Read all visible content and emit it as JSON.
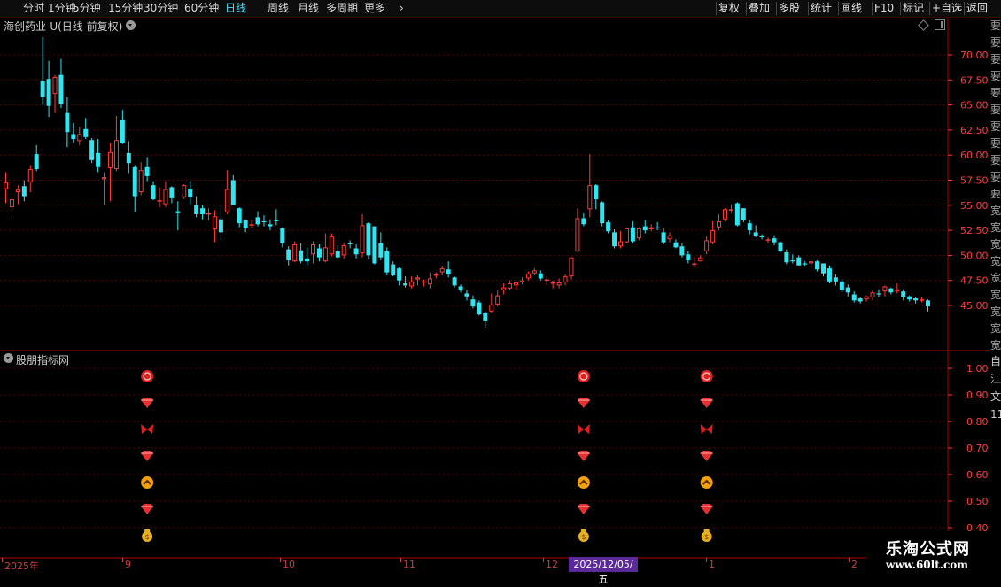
{
  "toolbar": {
    "timeframes": [
      "分时",
      "1分钟",
      "5分钟",
      "15分钟",
      "30分钟",
      "60分钟",
      "日线",
      "周线",
      "月线",
      "多周期",
      "更多"
    ],
    "active_timeframe": "日线",
    "right_buttons": [
      "复权",
      "叠加",
      "多股",
      "统计",
      "画线",
      "F10",
      "标记",
      "+自选",
      "返回"
    ]
  },
  "chart_title": "海创药业-U(日线 前复权)",
  "indicator_title": "股朋指标网",
  "right_strip_glyphs": "要要要要要要要要要要要宽宽宽宽宽宽宽宽宽宽",
  "right_strip2_glyphs": "自江文1111111",
  "date_highlight": "2025/12/05/五",
  "watermark": {
    "line1": "乐淘公式网",
    "line2": "www.60lt.com"
  },
  "colors": {
    "up": "#ff3a3a",
    "down": "#2fe6f0",
    "grid": "#5a0000",
    "axis": "#ff3c3c",
    "tf_active": "#3ee6ff"
  },
  "icons_column": [
    "gem-badge-icon",
    "diamond-icon",
    "butterfly-icon",
    "diamond-icon",
    "chevron-up-coin-icon",
    "diamond-icon",
    "money-bag-icon"
  ],
  "chart_data": {
    "type": "candlestick",
    "price_axis": {
      "ticks": [
        "70.00",
        "67.50",
        "65.00",
        "62.50",
        "60.00",
        "57.50",
        "55.00",
        "52.50",
        "50.00",
        "47.50",
        "45.00"
      ]
    },
    "indicator_axis": {
      "ticks": [
        "1.00",
        "0.90",
        "0.80",
        "0.70",
        "0.60",
        "0.50",
        "0.40"
      ]
    },
    "x_labels": [
      "2025年",
      "9",
      "10",
      "11",
      "12",
      "1",
      "2"
    ],
    "signal_columns_at_candles": [
      23,
      94,
      114
    ],
    "candles": [
      [
        56.6,
        57.3,
        55.2,
        58.3
      ],
      [
        54.8,
        55.6,
        53.6,
        56.2
      ],
      [
        56.3,
        56.6,
        55.1,
        57.0
      ],
      [
        56.9,
        55.9,
        55.4,
        57.5
      ],
      [
        57.3,
        58.6,
        56.3,
        59.0
      ],
      [
        60.1,
        58.6,
        58.4,
        61.0
      ],
      [
        67.4,
        65.8,
        65.0,
        71.8
      ],
      [
        67.6,
        64.9,
        63.8,
        69.4
      ],
      [
        66.1,
        67.8,
        64.2,
        68.0
      ],
      [
        68.0,
        65.1,
        64.7,
        69.6
      ],
      [
        64.2,
        62.3,
        60.8,
        65.8
      ],
      [
        62.1,
        61.6,
        61.2,
        63.2
      ],
      [
        61.4,
        62.1,
        61.0,
        62.8
      ],
      [
        62.6,
        61.8,
        61.6,
        63.7
      ],
      [
        61.5,
        59.5,
        59.2,
        61.7
      ],
      [
        60.2,
        58.8,
        58.3,
        61.6
      ],
      [
        57.6,
        57.8,
        55.0,
        58.3
      ],
      [
        58.7,
        60.3,
        55.4,
        61.2
      ],
      [
        58.6,
        61.5,
        58.4,
        63.9
      ],
      [
        63.5,
        61.2,
        61.1,
        64.5
      ],
      [
        60.2,
        59.2,
        58.2,
        61.4
      ],
      [
        58.8,
        55.9,
        54.3,
        59.0
      ],
      [
        56.3,
        58.5,
        56.0,
        59.3
      ],
      [
        58.8,
        57.9,
        57.4,
        59.8
      ],
      [
        57.0,
        55.6,
        55.5,
        57.4
      ],
      [
        55.5,
        55.5,
        54.8,
        56.8
      ],
      [
        55.1,
        56.6,
        54.8,
        57.4
      ],
      [
        56.8,
        55.7,
        55.2,
        56.9
      ],
      [
        54.4,
        54.2,
        52.5,
        55.4
      ],
      [
        55.8,
        57.0,
        55.6,
        57.1
      ],
      [
        56.6,
        55.8,
        55.0,
        57.4
      ],
      [
        55.0,
        54.1,
        53.8,
        55.9
      ],
      [
        54.7,
        54.1,
        53.6,
        55.0
      ],
      [
        54.1,
        54.2,
        53.5,
        54.7
      ],
      [
        52.6,
        53.9,
        51.3,
        54.5
      ],
      [
        53.6,
        52.3,
        51.5,
        54.9
      ],
      [
        54.3,
        56.6,
        54.1,
        58.5
      ],
      [
        57.5,
        55.0,
        55.0,
        58.0
      ],
      [
        54.7,
        53.2,
        52.8,
        54.8
      ],
      [
        53.5,
        52.7,
        52.3,
        53.6
      ],
      [
        53.0,
        53.1,
        52.7,
        53.5
      ],
      [
        53.8,
        53.1,
        52.9,
        54.4
      ],
      [
        53.4,
        53.3,
        52.9,
        54.0
      ],
      [
        53.1,
        52.9,
        52.5,
        53.6
      ],
      [
        53.5,
        53.4,
        53.0,
        54.6
      ],
      [
        52.7,
        51.2,
        50.8,
        52.8
      ],
      [
        50.6,
        49.5,
        49.0,
        50.9
      ],
      [
        49.4,
        51.1,
        49.3,
        51.4
      ],
      [
        50.5,
        49.4,
        49.2,
        51.2
      ],
      [
        49.7,
        49.4,
        49.0,
        50.8
      ],
      [
        50.1,
        51.1,
        49.2,
        51.4
      ],
      [
        50.7,
        49.8,
        49.4,
        51.1
      ],
      [
        49.4,
        50.8,
        49.3,
        52.2
      ],
      [
        50.1,
        51.9,
        49.9,
        52.2
      ],
      [
        50.4,
        49.8,
        49.6,
        51.0
      ],
      [
        50.0,
        51.0,
        49.7,
        51.3
      ],
      [
        51.2,
        51.1,
        50.7,
        51.5
      ],
      [
        50.7,
        50.1,
        49.7,
        51.1
      ],
      [
        50.2,
        53.0,
        49.8,
        54.1
      ],
      [
        53.2,
        50.0,
        49.6,
        53.3
      ],
      [
        52.9,
        49.2,
        49.1,
        52.9
      ],
      [
        51.2,
        49.8,
        49.5,
        52.3
      ],
      [
        50.4,
        48.3,
        48.0,
        50.8
      ],
      [
        49.1,
        48.0,
        47.9,
        49.4
      ],
      [
        48.7,
        47.5,
        47.0,
        48.8
      ],
      [
        47.2,
        47.0,
        46.8,
        47.9
      ],
      [
        46.9,
        47.4,
        46.7,
        47.9
      ],
      [
        47.6,
        47.8,
        47.0,
        48.0
      ],
      [
        47.3,
        47.4,
        46.9,
        47.6
      ],
      [
        47.1,
        47.7,
        46.7,
        48.3
      ],
      [
        48.0,
        48.1,
        47.7,
        48.3
      ],
      [
        48.3,
        48.7,
        48.0,
        48.9
      ],
      [
        48.6,
        48.1,
        47.8,
        49.4
      ],
      [
        47.8,
        47.0,
        46.8,
        47.9
      ],
      [
        46.9,
        46.5,
        46.3,
        47.1
      ],
      [
        46.2,
        45.9,
        45.5,
        46.6
      ],
      [
        45.6,
        44.9,
        44.7,
        46.0
      ],
      [
        45.3,
        44.1,
        44.0,
        45.5
      ],
      [
        44.3,
        43.5,
        42.8,
        44.4
      ],
      [
        44.4,
        45.1,
        44.3,
        46.2
      ],
      [
        45.1,
        46.0,
        44.9,
        46.5
      ],
      [
        46.5,
        46.8,
        46.1,
        47.2
      ],
      [
        46.7,
        47.2,
        46.5,
        47.5
      ],
      [
        47.0,
        47.3,
        46.6,
        47.4
      ],
      [
        47.3,
        47.5,
        47.1,
        47.8
      ],
      [
        47.7,
        48.2,
        47.5,
        48.4
      ],
      [
        48.2,
        48.5,
        48.0,
        48.7
      ],
      [
        48.2,
        47.7,
        47.5,
        48.5
      ],
      [
        47.6,
        47.6,
        47.0,
        47.9
      ],
      [
        47.2,
        47.3,
        46.7,
        47.5
      ],
      [
        47.0,
        47.3,
        46.7,
        47.7
      ],
      [
        47.3,
        47.9,
        47.0,
        48.1
      ],
      [
        47.9,
        49.8,
        47.6,
        49.8
      ],
      [
        50.4,
        53.7,
        50.3,
        54.7
      ],
      [
        53.7,
        53.1,
        52.9,
        54.2
      ],
      [
        54.6,
        57.0,
        53.8,
        60.1
      ],
      [
        57.0,
        55.6,
        54.6,
        57.1
      ],
      [
        55.3,
        53.2,
        52.9,
        55.4
      ],
      [
        53.3,
        52.4,
        52.2,
        53.5
      ],
      [
        52.3,
        50.9,
        50.7,
        52.6
      ],
      [
        50.9,
        51.4,
        50.7,
        52.4
      ],
      [
        51.3,
        52.7,
        51.2,
        52.8
      ],
      [
        52.8,
        51.4,
        51.2,
        53.4
      ],
      [
        51.7,
        52.7,
        51.5,
        52.8
      ],
      [
        52.9,
        52.5,
        52.2,
        53.5
      ],
      [
        52.6,
        52.8,
        52.4,
        53.1
      ],
      [
        52.8,
        52.7,
        52.5,
        53.3
      ],
      [
        52.3,
        51.3,
        51.1,
        52.7
      ],
      [
        51.6,
        52.0,
        51.3,
        52.3
      ],
      [
        51.3,
        50.8,
        50.7,
        51.6
      ],
      [
        50.9,
        50.0,
        49.8,
        51.2
      ],
      [
        50.1,
        49.5,
        49.2,
        50.4
      ],
      [
        49.1,
        49.2,
        48.8,
        49.9
      ],
      [
        49.4,
        49.8,
        49.4,
        50.0
      ],
      [
        50.4,
        51.5,
        50.1,
        51.9
      ],
      [
        51.3,
        52.5,
        51.1,
        53.4
      ],
      [
        52.8,
        53.4,
        52.5,
        54.1
      ],
      [
        53.6,
        54.6,
        53.4,
        54.7
      ],
      [
        54.5,
        54.6,
        54.2,
        55.1
      ],
      [
        55.2,
        53.0,
        52.9,
        55.3
      ],
      [
        54.7,
        53.5,
        53.3,
        54.7
      ],
      [
        53.2,
        52.5,
        52.1,
        53.5
      ],
      [
        52.3,
        51.9,
        51.8,
        53.0
      ],
      [
        51.9,
        51.8,
        51.6,
        52.1
      ],
      [
        51.6,
        51.6,
        51.2,
        51.8
      ],
      [
        51.7,
        51.3,
        51.0,
        52.0
      ],
      [
        51.3,
        50.4,
        50.3,
        51.4
      ],
      [
        50.3,
        49.3,
        49.1,
        50.6
      ],
      [
        49.5,
        49.4,
        49.2,
        50.1
      ],
      [
        49.8,
        49.0,
        49.0,
        50.0
      ],
      [
        49.2,
        49.1,
        48.9,
        49.4
      ],
      [
        49.2,
        49.4,
        48.6,
        49.6
      ],
      [
        49.4,
        48.6,
        48.4,
        49.5
      ],
      [
        49.2,
        48.2,
        47.9,
        49.2
      ],
      [
        48.7,
        47.4,
        47.2,
        49.0
      ],
      [
        47.8,
        47.4,
        47.0,
        48.1
      ],
      [
        47.4,
        46.5,
        46.3,
        47.6
      ],
      [
        46.8,
        46.3,
        45.9,
        47.1
      ],
      [
        46.1,
        45.5,
        45.3,
        46.4
      ],
      [
        45.7,
        45.4,
        45.2,
        45.8
      ],
      [
        45.6,
        45.9,
        45.4,
        46.0
      ],
      [
        45.8,
        46.3,
        45.5,
        46.5
      ],
      [
        46.2,
        46.1,
        45.8,
        46.6
      ],
      [
        46.4,
        46.9,
        45.9,
        47.0
      ],
      [
        46.7,
        46.3,
        46.1,
        46.8
      ],
      [
        46.4,
        46.6,
        46.2,
        47.2
      ],
      [
        46.4,
        45.8,
        45.5,
        46.6
      ],
      [
        45.9,
        45.6,
        45.4,
        46.0
      ],
      [
        45.7,
        45.5,
        45.2,
        45.8
      ],
      [
        45.6,
        45.6,
        45.3,
        45.8
      ],
      [
        45.5,
        44.9,
        44.4,
        45.6
      ]
    ]
  }
}
